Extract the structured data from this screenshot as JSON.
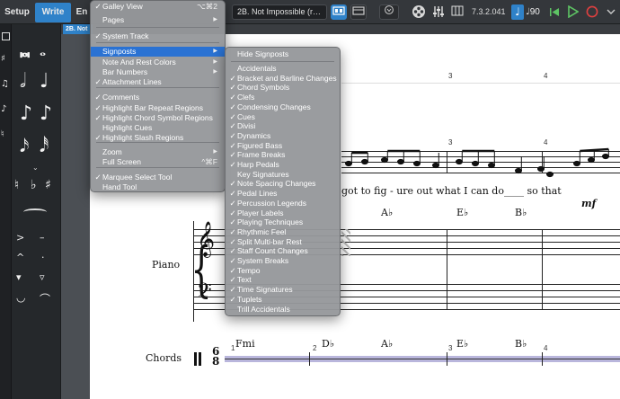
{
  "topbar": {
    "modes": [
      "Setup",
      "Write",
      "En"
    ],
    "layout_select": "2B. Not Impossible (r…",
    "version": "7.3.2.041",
    "tempo": "90",
    "flow_tab": "2B. Not"
  },
  "view_menu": {
    "items": [
      {
        "label": "Galley View",
        "checked": true,
        "shortcut": "⌥⌘2",
        "submenu": false
      },
      {
        "label": "Pages",
        "checked": false,
        "shortcut": "",
        "submenu": true
      },
      {
        "label": "System Track",
        "checked": true,
        "shortcut": "",
        "submenu": false
      },
      {
        "label": "Signposts",
        "checked": false,
        "shortcut": "",
        "submenu": true,
        "highlighted": true
      },
      {
        "label": "Note And Rest Colors",
        "checked": false,
        "shortcut": "",
        "submenu": true
      },
      {
        "label": "Bar Numbers",
        "checked": false,
        "shortcut": "",
        "submenu": true
      },
      {
        "label": "Attachment Lines",
        "checked": true,
        "shortcut": "",
        "submenu": false
      },
      {
        "label": "Comments",
        "checked": true,
        "shortcut": "",
        "submenu": false
      },
      {
        "label": "Highlight Bar Repeat Regions",
        "checked": true,
        "shortcut": "",
        "submenu": false
      },
      {
        "label": "Highlight Chord Symbol Regions",
        "checked": true,
        "shortcut": "",
        "submenu": false
      },
      {
        "label": "Highlight Cues",
        "checked": false,
        "shortcut": "",
        "submenu": false
      },
      {
        "label": "Highlight Slash Regions",
        "checked": true,
        "shortcut": "",
        "submenu": false
      },
      {
        "label": "Zoom",
        "checked": false,
        "shortcut": "",
        "submenu": true
      },
      {
        "label": "Full Screen",
        "checked": false,
        "shortcut": "^⌘F",
        "submenu": false
      },
      {
        "label": "Marquee Select Tool",
        "checked": true,
        "shortcut": "",
        "submenu": false
      },
      {
        "label": "Hand Tool",
        "checked": false,
        "shortcut": "",
        "submenu": false
      }
    ]
  },
  "signposts_menu": {
    "items": [
      {
        "label": "Hide Signposts",
        "checked": false
      },
      {
        "label": "Accidentals",
        "checked": false
      },
      {
        "label": "Bracket and Barline Changes",
        "checked": true
      },
      {
        "label": "Chord Symbols",
        "checked": true
      },
      {
        "label": "Clefs",
        "checked": true
      },
      {
        "label": "Condensing Changes",
        "checked": true
      },
      {
        "label": "Cues",
        "checked": true
      },
      {
        "label": "Divisi",
        "checked": true
      },
      {
        "label": "Dynamics",
        "checked": true
      },
      {
        "label": "Figured Bass",
        "checked": true
      },
      {
        "label": "Frame Breaks",
        "checked": true
      },
      {
        "label": "Harp Pedals",
        "checked": true
      },
      {
        "label": "Key Signatures",
        "checked": false
      },
      {
        "label": "Note Spacing Changes",
        "checked": true
      },
      {
        "label": "Pedal Lines",
        "checked": true
      },
      {
        "label": "Percussion Legends",
        "checked": true
      },
      {
        "label": "Player Labels",
        "checked": true
      },
      {
        "label": "Playing Techniques",
        "checked": true
      },
      {
        "label": "Rhythmic Feel",
        "checked": true
      },
      {
        "label": "Split Multi-bar Rest",
        "checked": true
      },
      {
        "label": "Staff Count Changes",
        "checked": true
      },
      {
        "label": "System Breaks",
        "checked": true
      },
      {
        "label": "Tempo",
        "checked": true
      },
      {
        "label": "Text",
        "checked": true
      },
      {
        "label": "Time Signatures",
        "checked": true
      },
      {
        "label": "Tuplets",
        "checked": true
      },
      {
        "label": "Trill Accidentals",
        "checked": false
      }
    ]
  },
  "score": {
    "lyrics": "got to fig - ure out what I can do____     so that",
    "dynamic": "mf",
    "chords_top": [
      "A♭",
      "E♭",
      "B♭"
    ],
    "instrument_piano": "Piano",
    "instrument_chords": "Chords",
    "chords_track": [
      "Fmi",
      "D♭",
      "A♭",
      "E♭",
      "B♭"
    ],
    "bar_numbers": [
      "3",
      "4",
      "1",
      "2",
      "3",
      "4"
    ],
    "time_sig_top": "6",
    "time_sig_bottom": "8"
  },
  "icons": {
    "check": "✓",
    "submenu_arrow": "▶",
    "flat": "♭",
    "sharp": "♯",
    "natural": "♮"
  }
}
